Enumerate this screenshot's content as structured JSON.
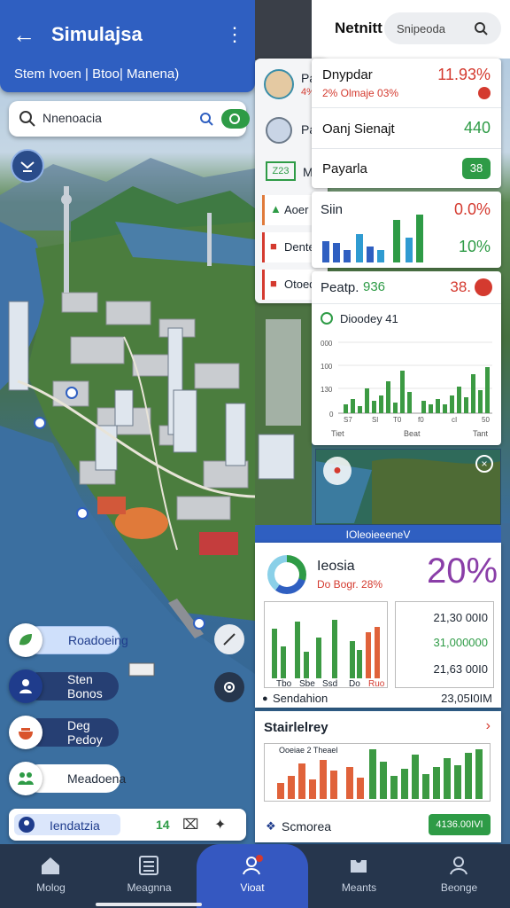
{
  "left": {
    "title": "Simulajsa",
    "subtitle": "Stem Ivoen | Btoo| Manena)",
    "search_text": "Nnenoacia",
    "chips": [
      {
        "label": "Roadoeing",
        "icon": "leaf-icon"
      },
      {
        "label": "Sten Bonos",
        "icon": "person-icon"
      },
      {
        "label": "Deg Pedoy",
        "icon": "bowl-icon"
      },
      {
        "label": "Meadoena",
        "icon": "people-icon"
      }
    ],
    "bottom_search": {
      "label": "Iendatzia",
      "value": "14"
    }
  },
  "right": {
    "brand": "Netnitt",
    "search_placeholder": "Snipeoda",
    "rows": [
      {
        "title": "Dnypdar",
        "sub": "2% Olmaje 03%",
        "value": "11.93%"
      },
      {
        "title": "Oanj Sienajt",
        "value": "440"
      },
      {
        "title": "Payarla",
        "value": "38"
      }
    ],
    "overlay": [
      {
        "label": "Pa",
        "sub": "4%"
      },
      {
        "label": "Pa"
      },
      {
        "label": "M",
        "badge": "Z23"
      },
      {
        "label": "Aoer"
      },
      {
        "label": "Dente"
      },
      {
        "label": "Otoed"
      }
    ],
    "mini_chart": {
      "title": "Siin",
      "value1": "0.0%",
      "value2": "10%"
    },
    "peak": {
      "label": "Peatp.",
      "value": "936",
      "value2": "38."
    },
    "daily_chart": {
      "title": "Dioodey 41",
      "xlabels": [
        "Tiet",
        "Beat",
        "Tant"
      ]
    },
    "stats_header": "IOleoieeeneV",
    "index_card": {
      "title": "Ieosia",
      "sub": "Do Bogr. 28%",
      "value": "20%"
    },
    "table_values": [
      "21,30 00I0",
      "31,000000",
      "21,63 00I0"
    ],
    "chart_xlabels": [
      "Tbo",
      "Sbe",
      "Ssd",
      "Do",
      "Ruo"
    ],
    "sandation": {
      "label": "Sendahion",
      "value": "23,05I0IM"
    },
    "stairs": {
      "title": "Stairlelrey",
      "chart_title": "Ooeiae 2 Theael"
    },
    "footer": {
      "label": "Scmorea",
      "value": "4136.00IVI"
    }
  },
  "nav": [
    {
      "label": "Molog",
      "icon": "home-icon"
    },
    {
      "label": "Meagnna",
      "icon": "list-icon"
    },
    {
      "label": "Vioat",
      "icon": "profile-alert-icon"
    },
    {
      "label": "Meants",
      "icon": "puzzle-icon"
    },
    {
      "label": "Beonge",
      "icon": "user-icon"
    }
  ],
  "colors": {
    "primary": "#2f5fc1",
    "green": "#2e9b46",
    "red": "#d43a2f",
    "nav": "#26364d"
  }
}
